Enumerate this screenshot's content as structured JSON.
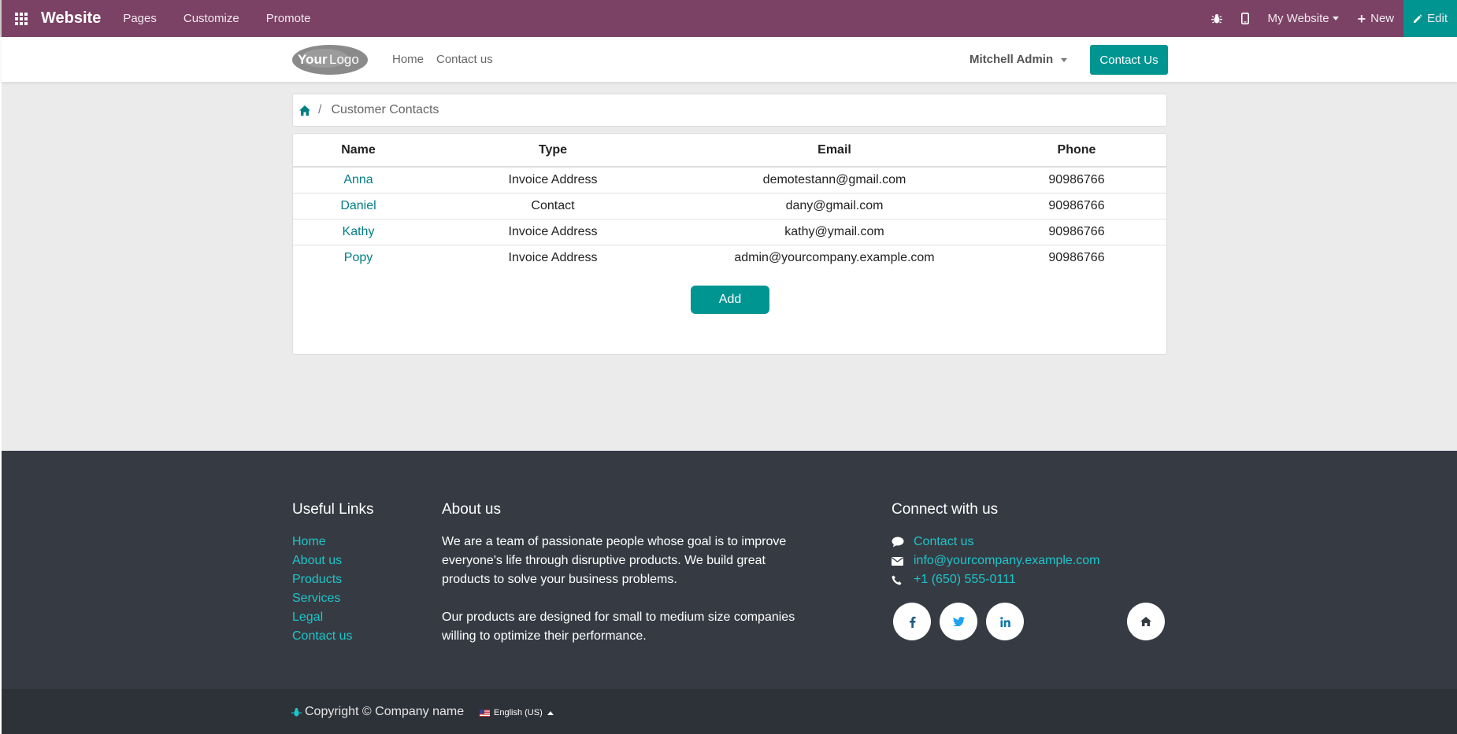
{
  "adminbar": {
    "brand": "Website",
    "menus": [
      "Pages",
      "Customize",
      "Promote"
    ],
    "website_selector": "My Website",
    "new_label": "New",
    "edit_label": "Edit",
    "bg_color": "#7b4265",
    "accent_color": "#019592"
  },
  "header": {
    "nav": [
      "Home",
      "Contact us"
    ],
    "user_name": "Mitchell Admin",
    "contact_button": "Contact Us"
  },
  "breadcrumb": {
    "current": "Customer Contacts"
  },
  "contacts_table": {
    "columns": [
      "Name",
      "Type",
      "Email",
      "Phone"
    ],
    "rows": [
      {
        "name": "Anna",
        "type": "Invoice Address",
        "email": "demotestann@gmail.com",
        "phone": "90986766"
      },
      {
        "name": "Daniel",
        "type": "Contact",
        "email": "dany@gmail.com",
        "phone": "90986766"
      },
      {
        "name": "Kathy",
        "type": "Invoice Address",
        "email": "kathy@ymail.com",
        "phone": "90986766"
      },
      {
        "name": "Popy",
        "type": "Invoice Address",
        "email": "admin@yourcompany.example.com",
        "phone": "90986766"
      }
    ]
  },
  "add_button": "Add",
  "footer": {
    "useful_links_title": "Useful Links",
    "useful_links": [
      "Home",
      "About us",
      "Products",
      "Services",
      "Legal",
      "Contact us"
    ],
    "about_title": "About us",
    "about_p1": "We are a team of passionate people whose goal is to improve everyone's life through disruptive products. We build great products to solve your business problems.",
    "about_p2": "Our products are designed for small to medium size companies willing to optimize their performance.",
    "connect_title": "Connect with us",
    "connect_contact": "Contact us",
    "connect_email": "info@yourcompany.example.com",
    "connect_phone": "+1 (650) 555-0111",
    "social_icons": [
      "facebook-icon",
      "twitter-icon",
      "linkedin-icon",
      "home-icon"
    ]
  },
  "copyright": {
    "text": "Copyright © Company name",
    "language": "English (US)"
  }
}
